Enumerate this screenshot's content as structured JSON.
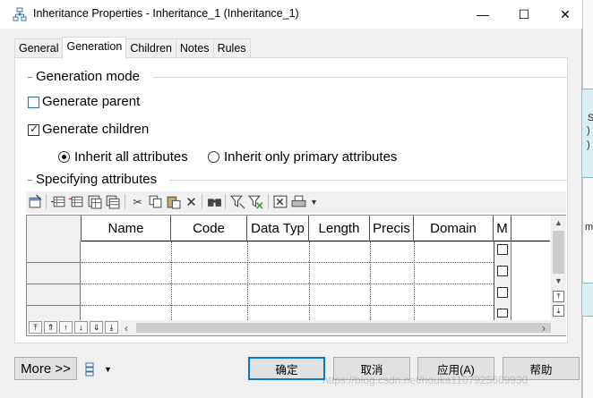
{
  "window": {
    "title": "Inheritance Properties - Inheritance_1 (Inheritance_1)",
    "minimize": "—",
    "maximize": "☐",
    "close": "✕"
  },
  "tabs": [
    {
      "label": "General"
    },
    {
      "label": "Generation",
      "active": true
    },
    {
      "label": "Children"
    },
    {
      "label": "Notes"
    },
    {
      "label": "Rules"
    }
  ],
  "generation_mode": {
    "heading": "Generation mode",
    "generate_parent": {
      "label": "Generate parent",
      "checked": false
    },
    "generate_children": {
      "label": "Generate children",
      "checked": true
    },
    "inherit_all": {
      "label": "Inherit all attributes",
      "selected": true
    },
    "inherit_primary": {
      "label": "Inherit only primary attributes",
      "selected": false
    }
  },
  "specifying": {
    "heading": "Specifying attributes",
    "columns": [
      "Name",
      "Code",
      "Data Typ",
      "Length",
      "Precis",
      "Domain",
      "M"
    ],
    "rows": [
      {
        "m_checked": false
      },
      {
        "m_checked": false
      },
      {
        "m_checked": false
      },
      {
        "m_checked": false
      }
    ]
  },
  "toolbar_icons": [
    "properties-icon",
    "add-row-icon",
    "insert-row-icon",
    "add-rows-icon",
    "copy-rows-icon",
    "cut-icon",
    "copy-icon",
    "paste-icon",
    "delete-icon",
    "find-icon",
    "filter-icon",
    "filter-clear-icon",
    "export-excel-icon",
    "print-icon",
    "dropdown-icon"
  ],
  "buttons": {
    "more": "More >>",
    "ok": "确定",
    "cancel": "取消",
    "apply": "应用(A)",
    "help": "帮助"
  },
  "background": {
    "watermark": "https://blog.csdn.net/houka1107925669930",
    "frag_s": "S",
    "frag_paren1": ")",
    "frag_paren2": ")",
    "frag_mb": "mb"
  },
  "colors": {
    "accent": "#0078d7",
    "panel_bg": "#ffffff",
    "window_bg": "#f0f0f0"
  }
}
